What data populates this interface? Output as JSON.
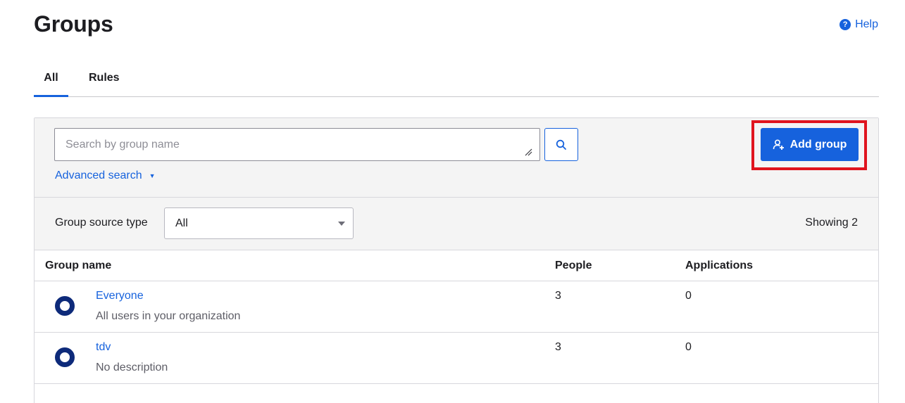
{
  "page": {
    "title": "Groups",
    "help_label": "Help"
  },
  "tabs": [
    {
      "label": "All",
      "active": true
    },
    {
      "label": "Rules",
      "active": false
    }
  ],
  "search": {
    "placeholder": "Search by group name",
    "value": "",
    "advanced_label": "Advanced search",
    "search_icon": "search-icon"
  },
  "add_group": {
    "label": "Add group",
    "icon": "add-user-icon",
    "highlight_color": "#e0141e"
  },
  "filter": {
    "label": "Group source type",
    "selected": "All",
    "showing": "Showing 2"
  },
  "table": {
    "headers": [
      "Group name",
      "People",
      "Applications"
    ],
    "rows": [
      {
        "name": "Everyone",
        "description": "All users in your organization",
        "people": "3",
        "applications": "0"
      },
      {
        "name": "tdv",
        "description": "No description",
        "people": "3",
        "applications": "0"
      }
    ]
  },
  "colors": {
    "accent": "#1662dd",
    "group_icon": "#0d2a7a"
  }
}
